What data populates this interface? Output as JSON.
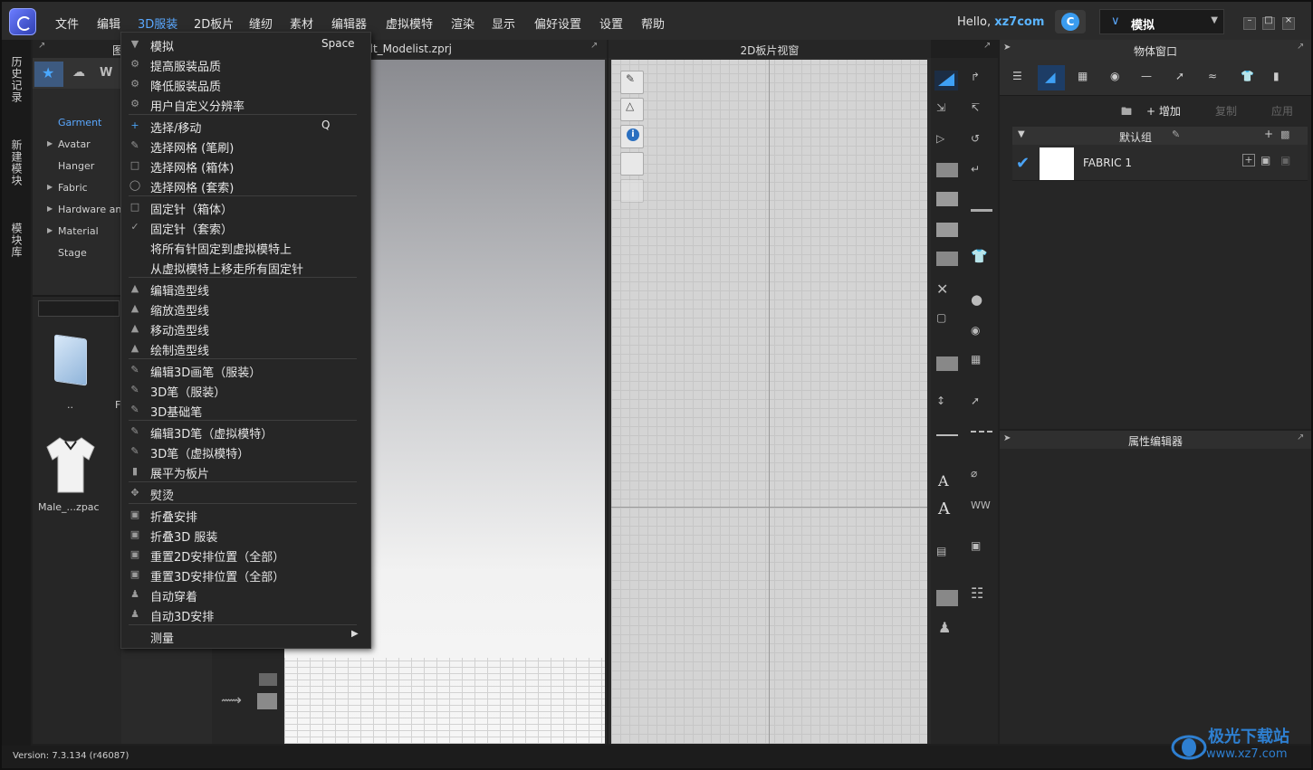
{
  "menubar": {
    "items": [
      "文件",
      "编辑",
      "3D服装",
      "2D板片",
      "缝纫",
      "素材",
      "编辑器",
      "虚拟模特",
      "渲染",
      "显示",
      "偏好设置",
      "设置",
      "帮助"
    ],
    "active_item": "3D服装",
    "hello_prefix": "Hello, ",
    "username": "xz7com",
    "cloud_icon_letter": "C",
    "mode_label": "模拟"
  },
  "left_tabs": [
    "历史记录",
    "新建模块",
    "模块库"
  ],
  "library": {
    "header_partial": "图",
    "tree": [
      {
        "label": "Garment",
        "selected": true,
        "expandable": false
      },
      {
        "label": "Avatar",
        "selected": false,
        "expandable": true
      },
      {
        "label": "Hanger",
        "selected": false,
        "expandable": false
      },
      {
        "label": "Fabric",
        "selected": false,
        "expandable": true
      },
      {
        "label": "Hardware and",
        "selected": false,
        "expandable": true
      },
      {
        "label": "Material",
        "selected": false,
        "expandable": true
      },
      {
        "label": "Stage",
        "selected": false,
        "expandable": false
      }
    ],
    "files": [
      {
        "label": "..",
        "icon": "folder-icon"
      },
      {
        "label": "Male_...zpac",
        "icon": "tshirt-icon"
      }
    ],
    "file_partial": "F"
  },
  "viewport3d": {
    "title_partial": "ult_Modelist.zprj"
  },
  "viewport2d": {
    "title": "2D板片视窗"
  },
  "object_window": {
    "title": "物体窗口",
    "actions": {
      "add_label": "增加",
      "copy_label": "复制",
      "apply_label": "应用"
    },
    "group_name": "默认组",
    "fabric_name": "FABRIC 1"
  },
  "property_editor": {
    "title": "属性编辑器"
  },
  "status": {
    "version": "Version: 7.3.134 (r46087)"
  },
  "watermark": {
    "text": "极光下载站",
    "url": "www.xz7.com"
  },
  "dropdown": {
    "items": [
      {
        "label": "模拟",
        "shortcut": "Space",
        "icon": "simulate-icon"
      },
      {
        "label": "提高服装品质",
        "shortcut": "",
        "icon": "quality-up-icon"
      },
      {
        "label": "降低服装品质",
        "shortcut": "",
        "icon": "quality-down-icon"
      },
      {
        "label": "用户自定义分辨率",
        "shortcut": "",
        "icon": "resolution-icon"
      },
      {
        "label": "选择/移动",
        "shortcut": "Q",
        "icon": "select-move-icon"
      },
      {
        "label": "选择网格 (笔刷)",
        "shortcut": "",
        "icon": "mesh-brush-icon"
      },
      {
        "label": "选择网格 (箱体)",
        "shortcut": "",
        "icon": "mesh-box-icon"
      },
      {
        "label": "选择网格 (套索)",
        "shortcut": "",
        "icon": "mesh-lasso-icon"
      },
      {
        "label": "固定针（箱体）",
        "shortcut": "",
        "icon": "pin-box-icon"
      },
      {
        "label": "固定针（套索）",
        "shortcut": "",
        "icon": "pin-lasso-icon"
      },
      {
        "label": "将所有针固定到虚拟模特上",
        "shortcut": "",
        "icon": ""
      },
      {
        "label": "从虚拟模特上移走所有固定针",
        "shortcut": "",
        "icon": ""
      },
      {
        "label": "编辑造型线",
        "shortcut": "",
        "icon": "edit-style-line-icon"
      },
      {
        "label": "缩放造型线",
        "shortcut": "",
        "icon": "scale-style-line-icon"
      },
      {
        "label": "移动造型线",
        "shortcut": "",
        "icon": "move-style-line-icon"
      },
      {
        "label": "绘制造型线",
        "shortcut": "",
        "icon": "draw-style-line-icon"
      },
      {
        "label": "编辑3D画笔（服装）",
        "shortcut": "",
        "icon": "edit-3d-brush-icon"
      },
      {
        "label": "3D笔（服装）",
        "shortcut": "",
        "icon": "3d-pen-icon"
      },
      {
        "label": "3D基础笔",
        "shortcut": "",
        "icon": "3d-basic-pen-icon"
      },
      {
        "label": "编辑3D笔（虚拟模特）",
        "shortcut": "",
        "icon": "edit-3d-pen-avatar-icon"
      },
      {
        "label": "3D笔（虚拟模特）",
        "shortcut": "",
        "icon": "3d-pen-avatar-icon"
      },
      {
        "label": "展平为板片",
        "shortcut": "",
        "icon": "flatten-icon"
      },
      {
        "label": "熨烫",
        "shortcut": "",
        "icon": "iron-icon"
      },
      {
        "label": "折叠安排",
        "shortcut": "",
        "icon": "fold-arrange-icon"
      },
      {
        "label": "折叠3D 服装",
        "shortcut": "",
        "icon": "fold-3d-icon"
      },
      {
        "label": "重置2D安排位置（全部）",
        "shortcut": "",
        "icon": "reset-2d-icon"
      },
      {
        "label": "重置3D安排位置（全部）",
        "shortcut": "",
        "icon": "reset-3d-icon"
      },
      {
        "label": "自动穿着",
        "shortcut": "",
        "icon": "auto-dress-icon"
      },
      {
        "label": "自动3D安排",
        "shortcut": "",
        "icon": "auto-3d-arrange-icon"
      },
      {
        "label": "测量",
        "shortcut": "",
        "icon": "",
        "submenu": true
      }
    ]
  }
}
